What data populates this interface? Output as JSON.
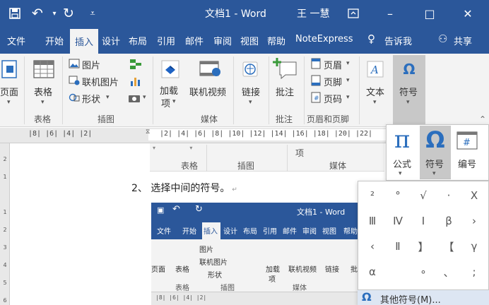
{
  "titlebar": {
    "save_icon": "save-icon",
    "undo_icon": "undo-icon",
    "redo_icon": "redo-icon",
    "customize_icon": "customize-quick-access-icon",
    "title": "文档1  -  Word",
    "user": "王 一慧",
    "ribbon_display_icon": "ribbon-display-options-icon",
    "minimize": "–",
    "maximize": "□",
    "close": "✕"
  },
  "tabs": {
    "file": "文件",
    "home": "开始",
    "insert": "插入",
    "design": "设计",
    "layout": "布局",
    "references": "引用",
    "mailings": "邮件",
    "review": "审阅",
    "view": "视图",
    "help": "帮助",
    "noteexpress": "NoteExpress",
    "tellme": "告诉我",
    "share": "共享"
  },
  "ribbon": {
    "page": "页面",
    "table": "表格",
    "table_group": "表格",
    "picture": "图片",
    "online_picture": "联机图片",
    "shapes": "形状",
    "illustrations_group": "插图",
    "addins_1": "加载",
    "addins_2": "项",
    "online_video": "联机视频",
    "media_group": "媒体",
    "link": "链接",
    "comment": "批注",
    "comment_group": "批注",
    "header": "页眉",
    "footer": "页脚",
    "page_number": "页码",
    "header_footer_group": "页眉和页脚",
    "text": "文本",
    "symbol": "符号"
  },
  "ruler": {
    "left_marks": "|8|  |6|  |4|  |2|",
    "right_marks": "|2|  |4|  |6|  |8|  |10|  |12|  |14|  |16|  |18|  |20|  |22|",
    "vertical_marks": [
      "2",
      "1",
      "",
      "1",
      "2",
      "3",
      "4",
      "5",
      "6"
    ]
  },
  "doc": {
    "inner_strip": [
      "表格",
      "插图",
      "项",
      "媒体"
    ],
    "step": "2、 选择中间的符号。",
    "inner_title": "文档1  -  Word",
    "inner_tabs": [
      "文件",
      "开始",
      "插入",
      "设计",
      "布局",
      "引用",
      "邮件",
      "审阅",
      "视图",
      "帮助"
    ],
    "inner_ribbon": [
      "页面",
      "表格",
      "图片",
      "联机图片",
      "形状",
      "加载",
      "项",
      "联机视频",
      "链接",
      "批"
    ],
    "inner_groups": [
      "表格",
      "插图",
      "媒体"
    ]
  },
  "symbol_popup": {
    "equation": "公式",
    "symbol": "符号",
    "number": "编号",
    "symbols": [
      "²",
      "°",
      "√",
      "·",
      "X",
      "Ⅲ",
      "Ⅳ",
      "Ⅰ",
      "β",
      "›",
      "‹",
      "Ⅱ",
      "】",
      "【",
      "γ",
      "α",
      "",
      "∘",
      "、",
      ";"
    ],
    "more_symbols": "其他符号(M)..."
  },
  "colors": {
    "word_blue": "#2b579a",
    "ribbon_bg": "#f3f3f3",
    "accent_blue": "#2b6ebd"
  }
}
